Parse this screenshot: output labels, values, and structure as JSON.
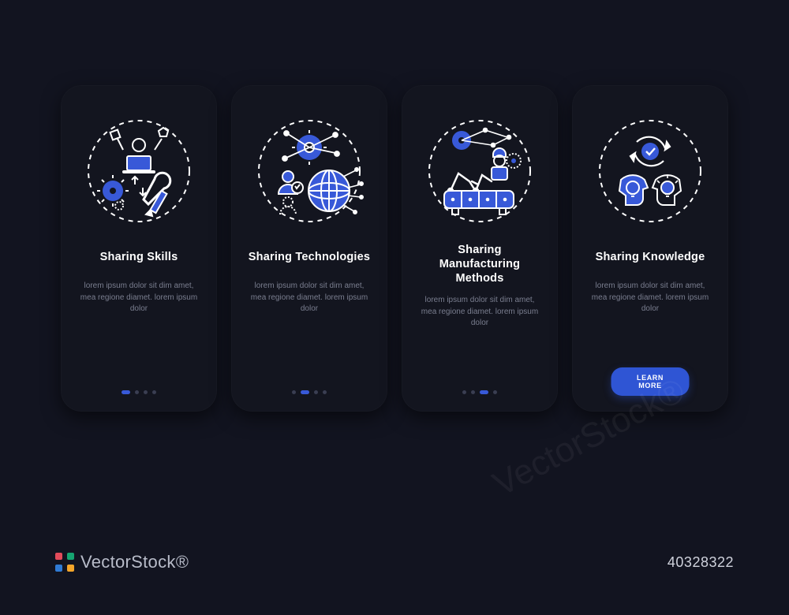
{
  "cards": [
    {
      "icon": "skills-icon",
      "title": "Sharing Skills",
      "desc": "lorem ipsum dolor sit dim amet, mea regione diamet. lorem ipsum dolor",
      "dots_active": 0
    },
    {
      "icon": "technologies-icon",
      "title": "Sharing Technologies",
      "desc": "lorem ipsum dolor sit dim amet, mea regione diamet. lorem ipsum dolor",
      "dots_active": 1
    },
    {
      "icon": "manufacturing-icon",
      "title": "Sharing Manufacturing Methods",
      "desc": "lorem ipsum dolor sit dim amet, mea regione diamet. lorem ipsum dolor",
      "dots_active": 2
    },
    {
      "icon": "knowledge-icon",
      "title": "Sharing Knowledge",
      "desc": "lorem ipsum dolor sit dim amet, mea regione diamet. lorem ipsum dolor",
      "cta": "LEARN MORE"
    }
  ],
  "brand": "VectorStock®",
  "watermark_id": "40328322",
  "watermark_diag": "VectorStock®",
  "colors": {
    "accent": "#3859d8",
    "bg": "#121420"
  }
}
